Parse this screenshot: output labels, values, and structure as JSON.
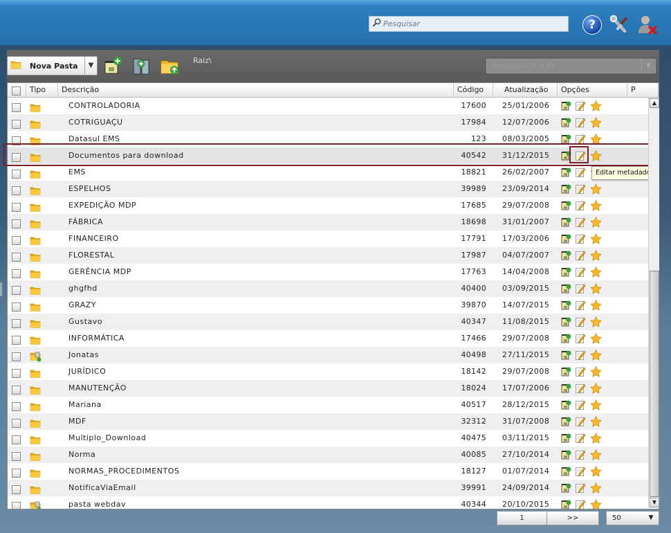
{
  "header": {
    "search_placeholder": "Pesquisar",
    "help_label": "?"
  },
  "toolbar": {
    "new_folder_label": "Nova Pasta",
    "breadcrumb": "Raiz\\",
    "view_select_value": "Descrição (A > Z)"
  },
  "table": {
    "columns": {
      "tipo": "Tipo",
      "descricao": "Descrição",
      "codigo": "Código",
      "atualizacao": "Atualização",
      "opcoes": "Opções",
      "p": "P"
    },
    "rows": [
      {
        "desc": "CONTROLADORIA",
        "code": "17600",
        "date": "25/01/2006",
        "type": "folder"
      },
      {
        "desc": "COTRIGUAÇU",
        "code": "17984",
        "date": "12/07/2006",
        "type": "folder"
      },
      {
        "desc": "Datasul EMS",
        "code": "123",
        "date": "08/03/2005",
        "type": "folder"
      },
      {
        "desc": "Documentos para download",
        "code": "40542",
        "date": "31/12/2015",
        "type": "folder"
      },
      {
        "desc": "EMS",
        "code": "18821",
        "date": "26/02/2007",
        "type": "folder"
      },
      {
        "desc": "ESPELHOS",
        "code": "39989",
        "date": "23/09/2014",
        "type": "folder"
      },
      {
        "desc": "EXPEDIÇÃO MDP",
        "code": "17685",
        "date": "29/07/2008",
        "type": "folder"
      },
      {
        "desc": "FÁBRICA",
        "code": "18698",
        "date": "31/01/2007",
        "type": "folder"
      },
      {
        "desc": "FINANCEIRO",
        "code": "17791",
        "date": "17/03/2006",
        "type": "folder"
      },
      {
        "desc": "FLORESTAL",
        "code": "17987",
        "date": "04/07/2007",
        "type": "folder"
      },
      {
        "desc": "GERÊNCIA MDP",
        "code": "17763",
        "date": "14/04/2008",
        "type": "folder"
      },
      {
        "desc": "ghgfhd",
        "code": "40400",
        "date": "03/09/2015",
        "type": "folder"
      },
      {
        "desc": "GRAZY",
        "code": "39870",
        "date": "14/07/2015",
        "type": "folder"
      },
      {
        "desc": "Gustavo",
        "code": "40347",
        "date": "11/08/2015",
        "type": "folder"
      },
      {
        "desc": "INFORMÁTICA",
        "code": "17466",
        "date": "29/07/2008",
        "type": "folder"
      },
      {
        "desc": "Jonatas",
        "code": "40498",
        "date": "27/11/2015",
        "type": "shared-folder"
      },
      {
        "desc": "JURÍDICO",
        "code": "18142",
        "date": "29/07/2008",
        "type": "folder"
      },
      {
        "desc": "MANUTENÇÃO",
        "code": "18024",
        "date": "17/07/2006",
        "type": "folder"
      },
      {
        "desc": "Mariana",
        "code": "40517",
        "date": "28/12/2015",
        "type": "folder"
      },
      {
        "desc": "MDF",
        "code": "32312",
        "date": "31/07/2008",
        "type": "folder"
      },
      {
        "desc": "Multiplo_Download",
        "code": "40475",
        "date": "03/11/2015",
        "type": "folder"
      },
      {
        "desc": "Norma",
        "code": "40085",
        "date": "27/10/2014",
        "type": "folder"
      },
      {
        "desc": "NORMAS_PROCEDIMENTOS",
        "code": "18127",
        "date": "01/07/2014",
        "type": "folder"
      },
      {
        "desc": "NotificaViaEmail",
        "code": "39991",
        "date": "24/09/2014",
        "type": "folder"
      },
      {
        "desc": "pasta webdav",
        "code": "40344",
        "date": "20/10/2015",
        "type": "shared-folder"
      }
    ],
    "selected_row_index": 3
  },
  "tooltip": {
    "text": "Editar metadados"
  },
  "pager": {
    "current_page": "1",
    "next_label": ">>",
    "per_page": "50"
  },
  "colors": {
    "topbar": "#2a79b8",
    "toolbar": "#5e5e5e",
    "selection_outline": "#7a1e2a",
    "folder": "#f2b51c"
  }
}
